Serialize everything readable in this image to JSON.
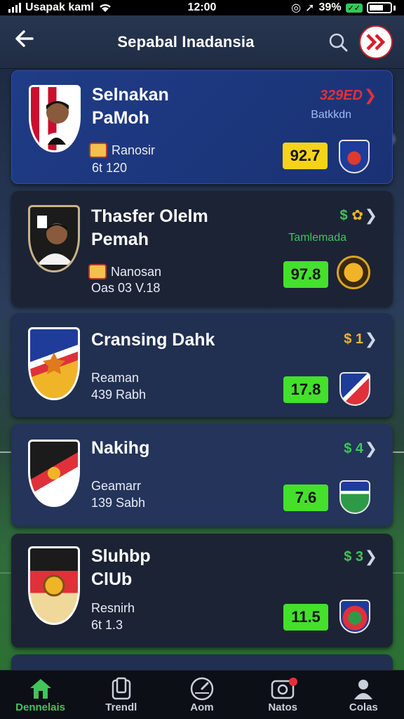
{
  "status_bar": {
    "carrier": "Usapak kaml",
    "time": "12:00",
    "battery": "39%",
    "charge_label": "✓✓"
  },
  "header": {
    "title": "Sepabal Inadansia",
    "back_icon": "arrow-left-icon",
    "search_icon": "search-icon",
    "brand_icon": "double-chevron-logo-icon"
  },
  "colors": {
    "accent_green": "#3fc55a",
    "rating_yellow": "#f5d31b",
    "rating_green": "#44e02c",
    "price_red": "#e0313a",
    "price_gold": "#f0b429"
  },
  "cards": [
    {
      "name_line1": "Selnakan",
      "name_line2": "PaMoh",
      "price": "329ED",
      "tag": "Batkkdn",
      "club": "Ranosir",
      "stats": "6t  120",
      "rating": "92.7",
      "rating_color": "yellow"
    },
    {
      "name_line1": "Thasfer Olelm",
      "name_line2": "Pemah",
      "price": "$",
      "tag": "Tamlemada",
      "club": "Nanosan",
      "stats": "Oas 03 V.18",
      "rating": "97.8",
      "rating_color": "green"
    },
    {
      "name_line1": "Cransing Dahk",
      "price": "$ 1",
      "club": "Reaman",
      "stats": "439 Rabh",
      "rating": "17.8",
      "rating_color": "green"
    },
    {
      "name_line1": "Nakihg",
      "price": "$ 4",
      "club": "Geamarr",
      "stats": "139 Sabh",
      "rating": "7.6",
      "rating_color": "green"
    },
    {
      "name_line1": "Sluhbp",
      "name_line2": "ClUb",
      "price": "$ 3",
      "club": "Resnirh",
      "stats": "6t  1.3",
      "rating": "11.5",
      "rating_color": "green"
    }
  ],
  "nav": [
    {
      "label": "Dennelais",
      "icon": "home-icon",
      "active": true
    },
    {
      "label": "Trendl",
      "icon": "cards-icon",
      "active": false
    },
    {
      "label": "Aom",
      "icon": "gauge-icon",
      "active": false
    },
    {
      "label": "Natos",
      "icon": "camera-icon",
      "active": false,
      "notification": true
    },
    {
      "label": "Colas",
      "icon": "profile-icon",
      "active": false
    }
  ]
}
